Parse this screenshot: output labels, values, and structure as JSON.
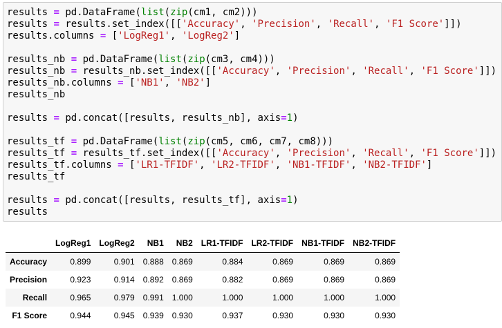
{
  "code_cell": {
    "lines": [
      [
        [
          "results",
          "plain"
        ],
        [
          " ",
          "plain"
        ],
        [
          "=",
          "op"
        ],
        [
          " pd.DataFrame(",
          "plain"
        ],
        [
          "list",
          "builtin"
        ],
        [
          "(",
          "plain"
        ],
        [
          "zip",
          "builtin"
        ],
        [
          "(cm1, cm2)))",
          "plain"
        ]
      ],
      [
        [
          "results",
          "plain"
        ],
        [
          " ",
          "plain"
        ],
        [
          "=",
          "op"
        ],
        [
          " results.set_index([[",
          "plain"
        ],
        [
          "'Accuracy'",
          "str"
        ],
        [
          ", ",
          "plain"
        ],
        [
          "'Precision'",
          "str"
        ],
        [
          ", ",
          "plain"
        ],
        [
          "'Recall'",
          "str"
        ],
        [
          ", ",
          "plain"
        ],
        [
          "'F1 Score'",
          "str"
        ],
        [
          "]])",
          "plain"
        ]
      ],
      [
        [
          "results.columns",
          "plain"
        ],
        [
          " ",
          "plain"
        ],
        [
          "=",
          "op"
        ],
        [
          " [",
          "plain"
        ],
        [
          "'LogReg1'",
          "str"
        ],
        [
          ", ",
          "plain"
        ],
        [
          "'LogReg2'",
          "str"
        ],
        [
          "]",
          "plain"
        ]
      ],
      [],
      [
        [
          "results_nb",
          "plain"
        ],
        [
          " ",
          "plain"
        ],
        [
          "=",
          "op"
        ],
        [
          " pd.DataFrame(",
          "plain"
        ],
        [
          "list",
          "builtin"
        ],
        [
          "(",
          "plain"
        ],
        [
          "zip",
          "builtin"
        ],
        [
          "(cm3, cm4)))",
          "plain"
        ]
      ],
      [
        [
          "results_nb",
          "plain"
        ],
        [
          " ",
          "plain"
        ],
        [
          "=",
          "op"
        ],
        [
          " results_nb.set_index([[",
          "plain"
        ],
        [
          "'Accuracy'",
          "str"
        ],
        [
          ", ",
          "plain"
        ],
        [
          "'Precision'",
          "str"
        ],
        [
          ", ",
          "plain"
        ],
        [
          "'Recall'",
          "str"
        ],
        [
          ", ",
          "plain"
        ],
        [
          "'F1 Score'",
          "str"
        ],
        [
          "]])",
          "plain"
        ]
      ],
      [
        [
          "results_nb.columns",
          "plain"
        ],
        [
          " ",
          "plain"
        ],
        [
          "=",
          "op"
        ],
        [
          " [",
          "plain"
        ],
        [
          "'NB1'",
          "str"
        ],
        [
          ", ",
          "plain"
        ],
        [
          "'NB2'",
          "str"
        ],
        [
          "]",
          "plain"
        ]
      ],
      [
        [
          "results_nb",
          "plain"
        ]
      ],
      [],
      [
        [
          "results",
          "plain"
        ],
        [
          " ",
          "plain"
        ],
        [
          "=",
          "op"
        ],
        [
          " pd.concat([results, results_nb], axis",
          "plain"
        ],
        [
          "=",
          "op"
        ],
        [
          "1",
          "num"
        ],
        [
          ")",
          "plain"
        ]
      ],
      [],
      [
        [
          "results_tf",
          "plain"
        ],
        [
          " ",
          "plain"
        ],
        [
          "=",
          "op"
        ],
        [
          " pd.DataFrame(",
          "plain"
        ],
        [
          "list",
          "builtin"
        ],
        [
          "(",
          "plain"
        ],
        [
          "zip",
          "builtin"
        ],
        [
          "(cm5, cm6, cm7, cm8)))",
          "plain"
        ]
      ],
      [
        [
          "results_tf",
          "plain"
        ],
        [
          " ",
          "plain"
        ],
        [
          "=",
          "op"
        ],
        [
          " results_tf.set_index([[",
          "plain"
        ],
        [
          "'Accuracy'",
          "str"
        ],
        [
          ", ",
          "plain"
        ],
        [
          "'Precision'",
          "str"
        ],
        [
          ", ",
          "plain"
        ],
        [
          "'Recall'",
          "str"
        ],
        [
          ", ",
          "plain"
        ],
        [
          "'F1 Score'",
          "str"
        ],
        [
          "]])",
          "plain"
        ]
      ],
      [
        [
          "results_tf.columns",
          "plain"
        ],
        [
          " ",
          "plain"
        ],
        [
          "=",
          "op"
        ],
        [
          " [",
          "plain"
        ],
        [
          "'LR1-TFIDF'",
          "str"
        ],
        [
          ", ",
          "plain"
        ],
        [
          "'LR2-TFIDF'",
          "str"
        ],
        [
          ", ",
          "plain"
        ],
        [
          "'NB1-TFIDF'",
          "str"
        ],
        [
          ", ",
          "plain"
        ],
        [
          "'NB2-TFIDF'",
          "str"
        ],
        [
          "]",
          "plain"
        ]
      ],
      [
        [
          "results_tf",
          "plain"
        ]
      ],
      [],
      [
        [
          "results",
          "plain"
        ],
        [
          " ",
          "plain"
        ],
        [
          "=",
          "op"
        ],
        [
          " pd.concat([results, results_tf], axis",
          "plain"
        ],
        [
          "=",
          "op"
        ],
        [
          "1",
          "num"
        ],
        [
          ")",
          "plain"
        ]
      ],
      [
        [
          "results",
          "plain"
        ]
      ]
    ]
  },
  "output_table": {
    "corner": "",
    "columns": [
      "LogReg1",
      "LogReg2",
      "NB1",
      "NB2",
      "LR1-TFIDF",
      "LR2-TFIDF",
      "NB1-TFIDF",
      "NB2-TFIDF"
    ],
    "rows": [
      {
        "label": "Accuracy",
        "values": [
          "0.899",
          "0.901",
          "0.888",
          "0.869",
          "0.884",
          "0.869",
          "0.869",
          "0.869"
        ]
      },
      {
        "label": "Precision",
        "values": [
          "0.923",
          "0.914",
          "0.892",
          "0.869",
          "0.882",
          "0.869",
          "0.869",
          "0.869"
        ]
      },
      {
        "label": "Recall",
        "values": [
          "0.965",
          "0.979",
          "0.991",
          "1.000",
          "1.000",
          "1.000",
          "1.000",
          "1.000"
        ]
      },
      {
        "label": "F1 Score",
        "values": [
          "0.944",
          "0.945",
          "0.939",
          "0.930",
          "0.937",
          "0.930",
          "0.930",
          "0.930"
        ]
      }
    ]
  },
  "colors": {
    "cell_background": "#f7f7f7",
    "cell_border": "#cfcfcf",
    "operator": "#aa22ff",
    "string": "#ba2121",
    "builtin": "#008000",
    "number": "#008000",
    "table_stripe": "#f5f5f5"
  }
}
